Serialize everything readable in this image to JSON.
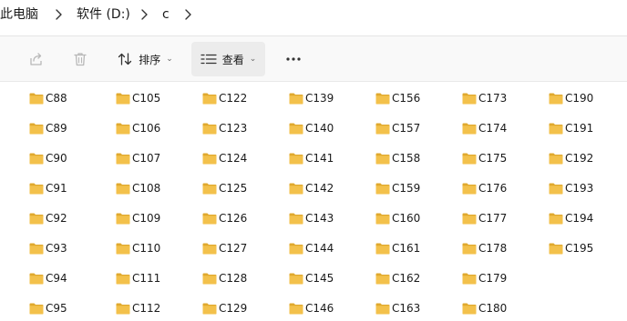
{
  "breadcrumb": {
    "items": [
      "此电脑",
      "软件 (D:)",
      "c"
    ]
  },
  "toolbar": {
    "share_icon": "share-icon",
    "delete_icon": "trash-icon",
    "sort_label": "排序",
    "view_label": "查看",
    "more_label": "···"
  },
  "folder_color": "#f3c14b",
  "files": {
    "columns": [
      [
        "C88",
        "C89",
        "C90",
        "C91",
        "C92",
        "C93",
        "C94",
        "C95"
      ],
      [
        "C105",
        "C106",
        "C107",
        "C108",
        "C109",
        "C110",
        "C111",
        "C112"
      ],
      [
        "C122",
        "C123",
        "C124",
        "C125",
        "C126",
        "C127",
        "C128",
        "C129"
      ],
      [
        "C139",
        "C140",
        "C141",
        "C142",
        "C143",
        "C144",
        "C145",
        "C146"
      ],
      [
        "C156",
        "C157",
        "C158",
        "C159",
        "C160",
        "C161",
        "C162",
        "C163"
      ],
      [
        "C173",
        "C174",
        "C175",
        "C176",
        "C177",
        "C178",
        "C179",
        "C180"
      ],
      [
        "C190",
        "C191",
        "C192",
        "C193",
        "C194",
        "C195"
      ]
    ]
  }
}
